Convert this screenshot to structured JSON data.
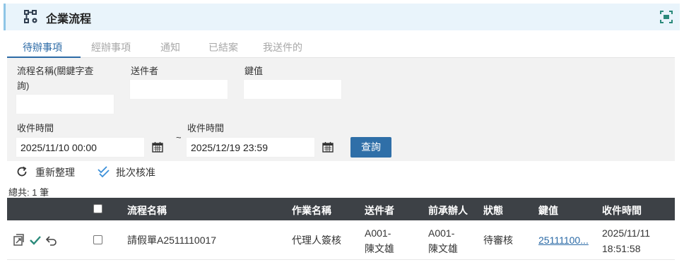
{
  "header": {
    "title": "企業流程",
    "title_icon": "workflow-icon",
    "expand_icon": "fullscreen-icon"
  },
  "tabs": [
    {
      "label": "待辦事項",
      "active": true
    },
    {
      "label": "經辦事項",
      "active": false
    },
    {
      "label": "通知",
      "active": false
    },
    {
      "label": "已結案",
      "active": false
    },
    {
      "label": "我送件的",
      "active": false
    }
  ],
  "filter": {
    "flow_name_label_line1": "流程名稱(關鍵字查",
    "flow_name_label_line2": "詢)",
    "flow_name_value": "",
    "sender_label": "送件者",
    "sender_value": "",
    "key_label": "鍵值",
    "key_value": "",
    "recv_from_label": "收件時間",
    "recv_from_value": "2025/11/10 00:00",
    "recv_to_label": "收件時間",
    "recv_to_value": "2025/12/19 23:59",
    "range_sep": "~",
    "query_button": "查詢"
  },
  "toolbar": {
    "refresh": "重新整理",
    "batch_approve": "批次核准"
  },
  "total_text": "總共: 1 筆",
  "grid": {
    "columns": [
      "流程名稱",
      "作業名稱",
      "送件者",
      "前承辦人",
      "狀態",
      "鍵值",
      "收件時間"
    ],
    "rows": [
      {
        "flow_name": "請假單A2511110017",
        "task_name": "代理人簽核",
        "sender_line1": "A001-",
        "sender_line2": "陳文雄",
        "prev_line1": "A001-",
        "prev_line2": "陳文雄",
        "status": "待審核",
        "key": "25111100...",
        "recv_date": "2025/11/11",
        "recv_time": "18:51:58"
      }
    ]
  },
  "colors": {
    "accent": "#2b6aa6",
    "header_bg": "#e9f4fb",
    "grid_header_bg": "#3d4146",
    "approve_green": "#2a8a7a"
  }
}
